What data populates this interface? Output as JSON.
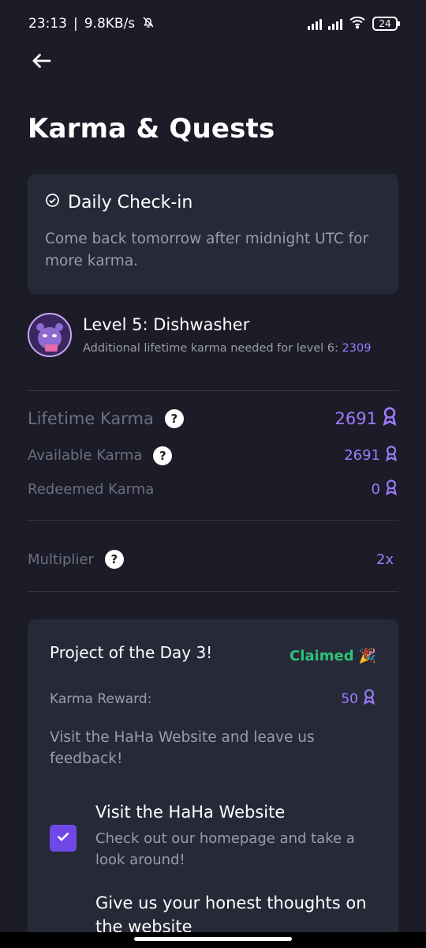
{
  "status_bar": {
    "time": "23:13",
    "speed": "9.8KB/s",
    "battery": "24"
  },
  "header": {
    "back_icon": "arrow-left-icon",
    "title": "Karma & Quests"
  },
  "daily_checkin": {
    "icon": "check-circle-icon",
    "title": "Daily Check-in",
    "message": "Come back tomorrow after midnight UTC for more karma."
  },
  "level": {
    "title": "Level 5: Dishwasher",
    "subtitle": "Additional lifetime karma needed for level 6:",
    "needed": "2309"
  },
  "stats": {
    "lifetime_label": "Lifetime Karma",
    "lifetime_value": "2691",
    "available_label": "Available Karma",
    "available_value": "2691",
    "redeemed_label": "Redeemed Karma",
    "redeemed_value": "0",
    "multiplier_label": "Multiplier",
    "multiplier_value": "2x",
    "help_glyph": "?"
  },
  "project": {
    "title": "Project of the Day 3!",
    "status": "Claimed",
    "status_emoji": "🎉",
    "reward_label": "Karma Reward:",
    "reward_value": "50",
    "description": "Visit the HaHa Website and leave us feedback!",
    "tasks": [
      {
        "title": "Visit the HaHa Website",
        "subtitle": "Check out our homepage and take a look around!",
        "checked": true
      },
      {
        "title": "Give us your honest thoughts on the website"
      }
    ]
  },
  "colors": {
    "background": "#1c1c28",
    "card": "#262a38",
    "accent": "#9d7cff",
    "success": "#2ec27a",
    "checkbox": "#7048e8"
  }
}
